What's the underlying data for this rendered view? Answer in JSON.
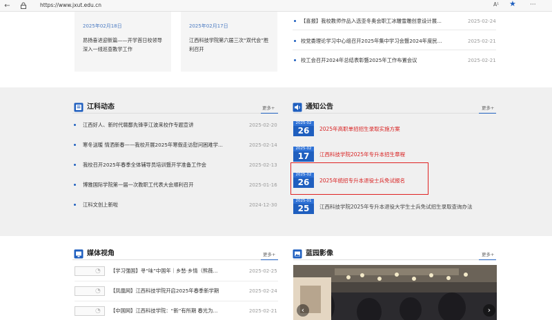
{
  "browser": {
    "url": "https://www.jxut.edu.cn",
    "read_aloud_label": "A¹",
    "more_label": "···"
  },
  "top": {
    "cards": [
      {
        "date": "2025年02月18日",
        "title": "昂扬奋进迎新篇——开学首日校领导深入一线巡查教学工作"
      },
      {
        "date": "2025年02月17日",
        "title": "江西科技学院第六届三次“双代会”胜利召开"
      }
    ],
    "news": [
      {
        "title": "【喜报】我校教师作品入选亚冬奥会职工冰雕雪雕创意设计展...",
        "date": "2025-02-24"
      },
      {
        "title": "校党委理论学习中心组召开2025年集中学习会暨2024年度民...",
        "date": "2025-02-21"
      },
      {
        "title": "校工会召开2024年总结表彰暨2025年工作布置会议",
        "date": "2025-02-21"
      }
    ]
  },
  "jiangke": {
    "title": "江科动态",
    "more": "更多+",
    "items": [
      {
        "title": "江西好人、新时代赣鄱先锋李江波来校作专题宣讲",
        "date": "2025-02-20"
      },
      {
        "title": "寒冬送暖 情洒新春——我校开展2025年寒假走访慰问困难学...",
        "date": "2025-02-14"
      },
      {
        "title": "我校召开2025年春季全体辅导员培训暨开学准备工作会",
        "date": "2025-02-13"
      },
      {
        "title": "博雅国际学院第一届一次教职工代表大会顺利召开",
        "date": "2025-01-16"
      },
      {
        "title": "江科文创上新啦",
        "date": "2024-12-30"
      }
    ]
  },
  "notices": {
    "title": "通知公告",
    "more": "更多+",
    "items": [
      {
        "ym": "2025-02",
        "day": "26",
        "title": "2025年高职单招招生录取实施方案",
        "color": "red"
      },
      {
        "ym": "2025-02",
        "day": "17",
        "title": "江西科技学院2025年专升本招生章程",
        "color": "red"
      },
      {
        "ym": "2025-02",
        "day": "26",
        "title": "2025年统招专升本退役士兵免试报名",
        "color": "red"
      },
      {
        "ym": "2025-01",
        "day": "25",
        "title": "江西科技学院2025年专升本退役大学生士兵免试招生录取查询办法",
        "color": "gray"
      }
    ]
  },
  "media": {
    "title": "媒体视角",
    "more": "更多+",
    "items": [
      {
        "title": "【学习强国】寻“味”中国年｜乡愁·乡情（熊薇...",
        "date": "2025-02-25"
      },
      {
        "title": "【凤凰网】江西科技学院开启2025年春季新学期",
        "date": "2025-02-24"
      },
      {
        "title": "【中国网】江西科技学院：“新”有所期 春光为...",
        "date": "2025-02-21"
      }
    ]
  },
  "campus": {
    "title": "蓝园影像",
    "more": "更多+"
  },
  "colors": {
    "accent": "#1f5fbf",
    "notice_red": "#d81e1e",
    "highlight_border": "#e02020"
  }
}
